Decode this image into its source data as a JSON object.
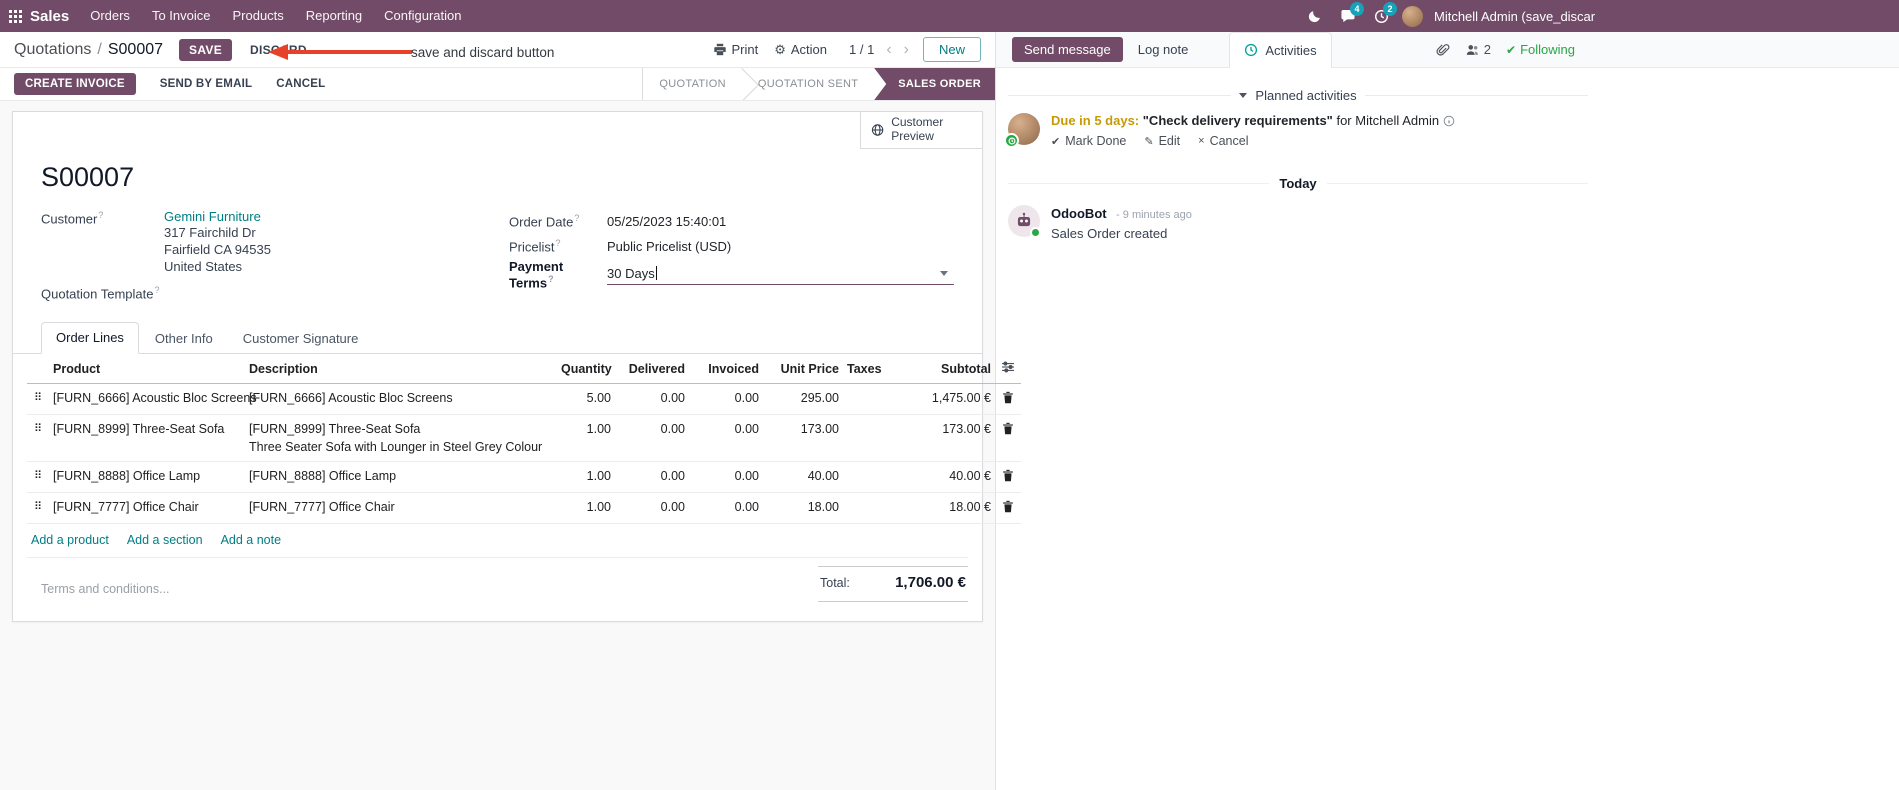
{
  "colors": {
    "primary": "#714B67",
    "link": "#017e84",
    "badge": "#17a2b8",
    "success": "#28a745",
    "edited_value": "#0b7ea8",
    "annotation_red": "#e8412a"
  },
  "topbar": {
    "app_name": "Sales",
    "menus": [
      "Orders",
      "To Invoice",
      "Products",
      "Reporting",
      "Configuration"
    ],
    "messages_badge": "4",
    "activities_badge": "2",
    "user_name": "Mitchell Admin (save_discar"
  },
  "breadcrumb": {
    "parent": "Quotations",
    "separator": "/",
    "current": "S00007",
    "save": "SAVE",
    "discard": "DISCARD"
  },
  "annotation": {
    "text": "save and discard button"
  },
  "actions": {
    "print": "Print",
    "action": "Action",
    "pager": "1 / 1",
    "prev": "‹",
    "next": "›",
    "new": "New"
  },
  "statusbar": {
    "create_invoice": "CREATE INVOICE",
    "send_by_email": "SEND BY EMAIL",
    "cancel": "CANCEL",
    "stages": [
      "QUOTATION",
      "QUOTATION SENT",
      "SALES ORDER"
    ],
    "active_stage": "SALES ORDER"
  },
  "sheet": {
    "customer_preview": "Customer Preview",
    "title": "S00007",
    "fields": {
      "customer_label": "Customer",
      "customer_name": "Gemini Furniture",
      "address_line1": "317 Fairchild Dr",
      "address_line2": "Fairfield CA 94535",
      "address_line3": "United States",
      "quotation_template_label": "Quotation Template",
      "order_date_label": "Order Date",
      "order_date_value": "05/25/2023 15:40:01",
      "pricelist_label": "Pricelist",
      "pricelist_value": "Public Pricelist (USD)",
      "payment_terms_label": "Payment Terms",
      "payment_terms_value": "30 Days"
    },
    "tabs": [
      "Order Lines",
      "Other Info",
      "Customer Signature"
    ],
    "active_tab": "Order Lines"
  },
  "table": {
    "headers": {
      "product": "Product",
      "description": "Description",
      "quantity": "Quantity",
      "delivered": "Delivered",
      "invoiced": "Invoiced",
      "unit_price": "Unit Price",
      "taxes": "Taxes",
      "subtotal": "Subtotal"
    },
    "rows": [
      {
        "product": "[FURN_6666] Acoustic Bloc Screens",
        "desc": "[FURN_6666] Acoustic Bloc Screens",
        "desc2": "",
        "quantity": "5.00",
        "delivered": "0.00",
        "invoiced": "0.00",
        "unit_price": "295.00",
        "taxes": "",
        "subtotal": "1,475.00 €"
      },
      {
        "product": "[FURN_8999] Three-Seat Sofa",
        "desc": "[FURN_8999] Three-Seat Sofa",
        "desc2": "Three Seater Sofa with Lounger in Steel Grey Colour",
        "quantity": "1.00",
        "delivered": "0.00",
        "invoiced": "0.00",
        "unit_price": "173.00",
        "taxes": "",
        "subtotal": "173.00 €"
      },
      {
        "product": "[FURN_8888] Office Lamp",
        "desc": "[FURN_8888] Office Lamp",
        "desc2": "",
        "quantity": "1.00",
        "delivered": "0.00",
        "invoiced": "0.00",
        "unit_price": "40.00",
        "taxes": "",
        "subtotal": "40.00 €"
      },
      {
        "product": "[FURN_7777] Office Chair",
        "desc": "[FURN_7777] Office Chair",
        "desc2": "",
        "quantity": "1.00",
        "delivered": "0.00",
        "invoiced": "0.00",
        "unit_price": "18.00",
        "taxes": "",
        "subtotal": "18.00 €"
      }
    ],
    "add_product": "Add a product",
    "add_section": "Add a section",
    "add_note": "Add a note"
  },
  "footer": {
    "terms_placeholder": "Terms and conditions...",
    "total_label": "Total:",
    "total_value": "1,706.00 €"
  },
  "chatter": {
    "send_message": "Send message",
    "log_note": "Log note",
    "activities": "Activities",
    "followers_count": "2",
    "following": "Following",
    "planned_header": "Planned activities",
    "activity": {
      "due": "Due in 5 days:",
      "summary": "\"Check delivery requirements\"",
      "assignee": "for Mitchell Admin",
      "mark_done": "Mark Done",
      "edit": "Edit",
      "cancel": "Cancel"
    },
    "date_divider": "Today",
    "message": {
      "author": "OdooBot",
      "time": "- 9 minutes ago",
      "body": "Sales Order created"
    }
  }
}
